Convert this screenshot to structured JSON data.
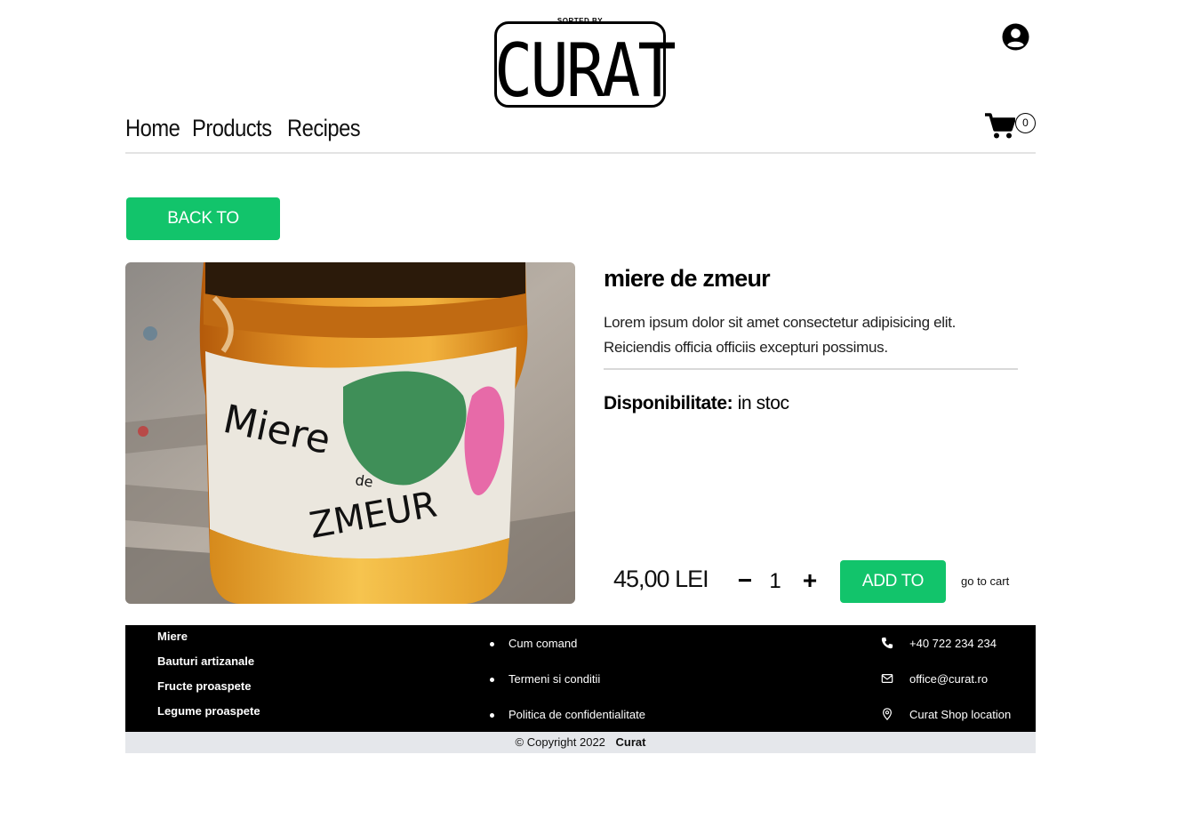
{
  "header": {
    "logo_tagline": "SORTED BY",
    "logo_text": "CURAT",
    "nav": [
      "Home",
      "Products",
      "Recipes"
    ],
    "cart_count": "0"
  },
  "back_button": "BACK TO PRODUCTS",
  "product": {
    "image_label_line1": "Miere",
    "image_label_de": "de",
    "image_label_line2": "ZMEUR",
    "title": "miere de zmeur",
    "description": "Lorem ipsum dolor sit amet consectetur adipisicing elit. Reiciendis officia officiis excepturi possimus.",
    "availability_label": "Disponibilitate:",
    "availability_value": "in stoc",
    "price": "45,00 LEI",
    "quantity": "1",
    "qty_minus": "−",
    "qty_plus": "+",
    "add_to_cart": "ADD TO CART",
    "go_to_cart": "go to cart"
  },
  "footer": {
    "categories": [
      "Miere",
      "Bauturi artizanale",
      "Fructe proaspete",
      "Legume proaspete"
    ],
    "links": [
      "Cum comand",
      "Termeni si conditii",
      "Politica de confidentialitate"
    ],
    "contact": {
      "phone": "+40 722 234 234",
      "email": "office@curat.ro",
      "location": "Curat Shop location"
    },
    "copyright_symbol": "©",
    "copyright_text": "Copyright 2022",
    "copyright_brand": "Curat"
  },
  "colors": {
    "accent": "#12c46b",
    "footer_bg": "#000000",
    "copyright_bg": "#e5e7eb"
  }
}
